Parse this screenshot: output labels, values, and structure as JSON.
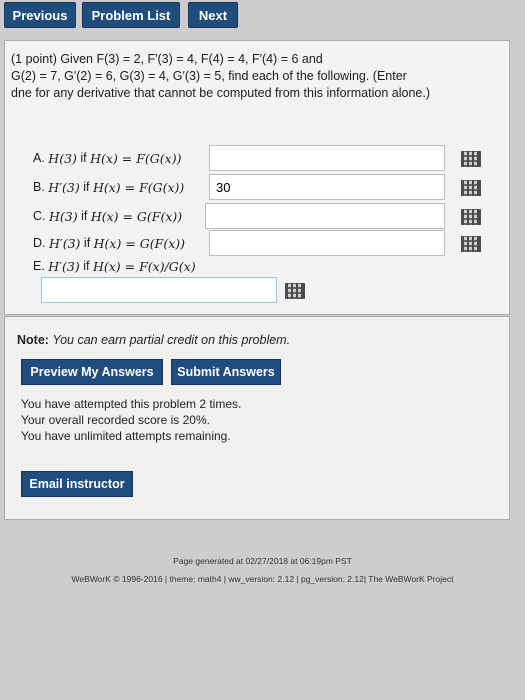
{
  "nav": {
    "previous_label": "Previous",
    "problem_list_label": "Problem List",
    "next_label": "Next"
  },
  "problem": {
    "intro_line1": "(1 point) Given F(3) = 2, F′(3) = 4, F(4) = 4, F′(4) = 6 and",
    "intro_line2": "G(2) = 7, G′(2) = 6, G(3) = 4, G′(3) = 5, find each of the following. (Enter",
    "intro_line3": "dne for any derivative that cannot be computed from this information alone.)",
    "parts": [
      {
        "letter": "A.",
        "expr": "H(3)",
        "if_text": "if",
        "def": "H(x) = F(G(x))",
        "value": ""
      },
      {
        "letter": "B.",
        "expr": "H′(3)",
        "if_text": "if",
        "def": "H(x) = F(G(x))",
        "value": "30"
      },
      {
        "letter": "C.",
        "expr": "H(3)",
        "if_text": "if",
        "def": "H(x) = G(F(x))",
        "value": ""
      },
      {
        "letter": "D.",
        "expr": "H′(3)",
        "if_text": "if",
        "def": "H(x) = G(F(x))",
        "value": ""
      },
      {
        "letter": "E.",
        "expr": "H′(3)",
        "if_text": "if",
        "def": "H(x) = F(x)/G(x)",
        "value": ""
      }
    ]
  },
  "note": {
    "label": "Note:",
    "text": "You can earn partial credit on this problem."
  },
  "buttons": {
    "preview": "Preview My Answers",
    "submit": "Submit Answers",
    "email": "Email instructor"
  },
  "status": {
    "attempted": "You have attempted this problem 2 times.",
    "score": "Your overall recorded score is 20%.",
    "attempts": "You have unlimited attempts remaining."
  },
  "footer": {
    "generated": "Page generated at 02/27/2018 at 06:19pm PST",
    "copyright": "WeBWorK © 1996-2016 | theme: math4 | ww_version: 2.12 | pg_version: 2.12| The WeBWorK Project"
  }
}
